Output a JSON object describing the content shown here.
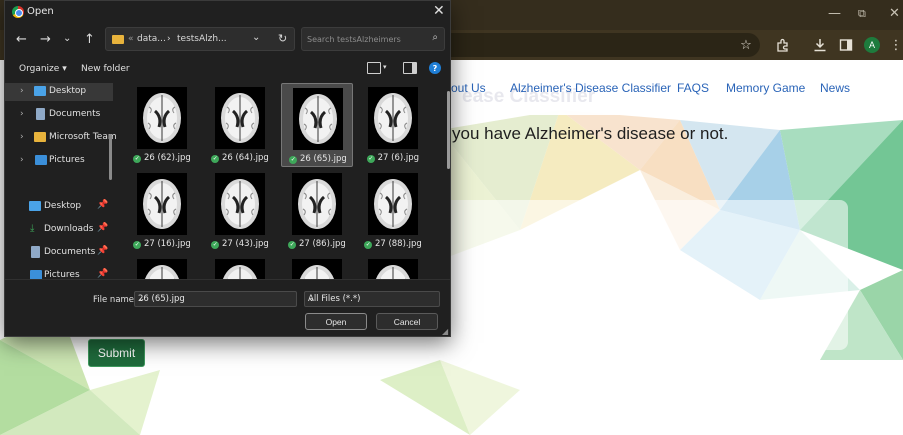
{
  "browser": {
    "window_controls": {
      "minimize": "—",
      "maximize": "⧉",
      "close": "✕"
    },
    "toolbar_icons": [
      "star-icon",
      "extensions-icon",
      "download-icon",
      "sidebar-icon"
    ],
    "profile_initial": "A"
  },
  "website": {
    "nav": {
      "about": "out Us",
      "classifier": "Alzheimer's Disease Classifier",
      "faqs": "FAQS",
      "game": "Memory Game",
      "news": "News"
    },
    "ghost_title": "ease Classifier",
    "subtitle": "you have Alzheimer's disease or not.",
    "submit_label": "Submit",
    "colors": {
      "nav_link": "#2a64b8",
      "submit": "#1f6b3c"
    }
  },
  "dialog": {
    "title": "Open",
    "breadcrumb": {
      "overflow": "«",
      "part1": "data...",
      "sep": "›",
      "part2": "testsAlzh..."
    },
    "search_placeholder": "Search testsAlzheimers",
    "organize": "Organize",
    "new_folder": "New folder",
    "nav_pane": [
      {
        "label": "Desktop",
        "icon": "desktop-icon",
        "expandable": true,
        "selected": true
      },
      {
        "label": "Documents",
        "icon": "documents-icon",
        "expandable": true
      },
      {
        "label": "Microsoft Team",
        "icon": "folder-icon",
        "expandable": true
      },
      {
        "label": "Pictures",
        "icon": "pictures-icon",
        "expandable": true
      },
      {
        "label": "Desktop",
        "icon": "desktop-icon",
        "pinned": true
      },
      {
        "label": "Downloads",
        "icon": "downloads-icon",
        "pinned": true
      },
      {
        "label": "Documents",
        "icon": "documents-icon",
        "pinned": true
      },
      {
        "label": "Pictures",
        "icon": "pictures-icon",
        "pinned": true
      }
    ],
    "files": [
      {
        "name": "26 (62).jpg",
        "synced": true
      },
      {
        "name": "26 (64).jpg",
        "synced": true
      },
      {
        "name": "26 (65).jpg",
        "synced": true,
        "selected": true
      },
      {
        "name": "27 (6).jpg",
        "synced": true
      },
      {
        "name": "27 (16).jpg",
        "synced": true
      },
      {
        "name": "27 (43).jpg",
        "synced": true
      },
      {
        "name": "27 (86).jpg",
        "synced": true
      },
      {
        "name": "27 (88).jpg",
        "synced": true
      },
      {
        "name": "",
        "synced": false
      },
      {
        "name": "",
        "synced": false
      },
      {
        "name": "",
        "synced": false
      },
      {
        "name": "",
        "synced": false
      }
    ],
    "file_name_label": "File name:",
    "file_name_value": "26 (65).jpg",
    "file_type": "All Files (*.*)",
    "open_label": "Open",
    "cancel_label": "Cancel"
  }
}
